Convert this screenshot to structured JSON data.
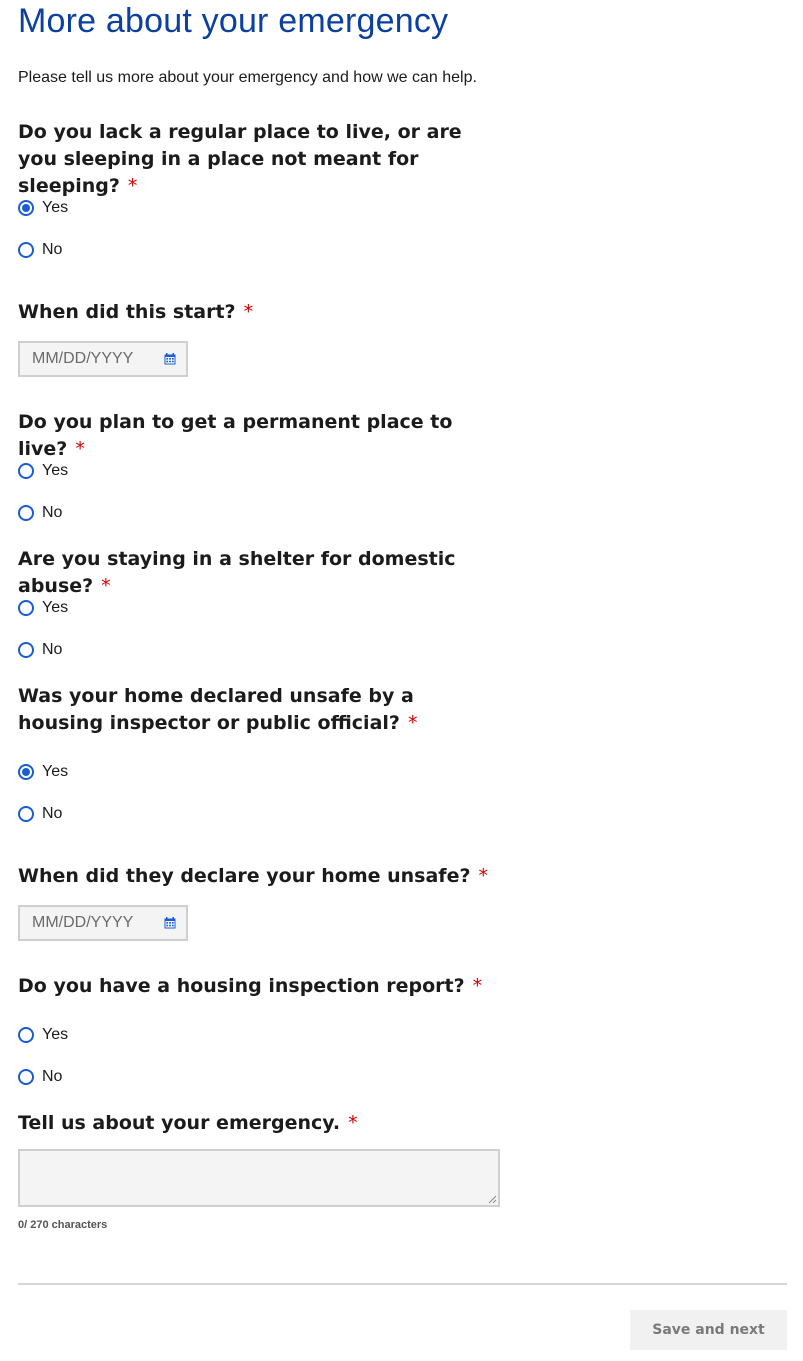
{
  "page": {
    "title": "More about your emergency",
    "intro": "Please tell us more about your emergency and how we can help."
  },
  "required_mark": "*",
  "questions": {
    "q1": {
      "label": "Do you lack a regular place to live, or are you sleeping in a place not meant for sleeping?",
      "options": [
        "Yes",
        "No"
      ],
      "selected": "Yes"
    },
    "q2": {
      "label": "When did this start?",
      "placeholder": "MM/DD/YYYY",
      "icon": "calendar-icon"
    },
    "q3": {
      "label": "Do you plan to get a permanent place to live?",
      "options": [
        "Yes",
        "No"
      ],
      "selected": ""
    },
    "q4": {
      "label": "Are you staying in a shelter for domestic abuse?",
      "options": [
        "Yes",
        "No"
      ],
      "selected": ""
    },
    "q5": {
      "label": "Was your home declared unsafe by a housing inspector or public official?",
      "options": [
        "Yes",
        "No"
      ],
      "selected": "Yes"
    },
    "q6": {
      "label": "When did they declare your home unsafe?",
      "placeholder": "MM/DD/YYYY",
      "icon": "calendar-icon"
    },
    "q7": {
      "label": "Do you have a housing inspection report?",
      "options": [
        "Yes",
        "No"
      ],
      "selected": ""
    },
    "q8": {
      "label": "Tell us about your emergency.",
      "value": "",
      "counter": "0/ 270 characters"
    }
  },
  "footer": {
    "save_label": "Save and next"
  },
  "colors": {
    "title": "#0b3fa0",
    "accent": "#1a5bd6",
    "required": "#d40000"
  }
}
